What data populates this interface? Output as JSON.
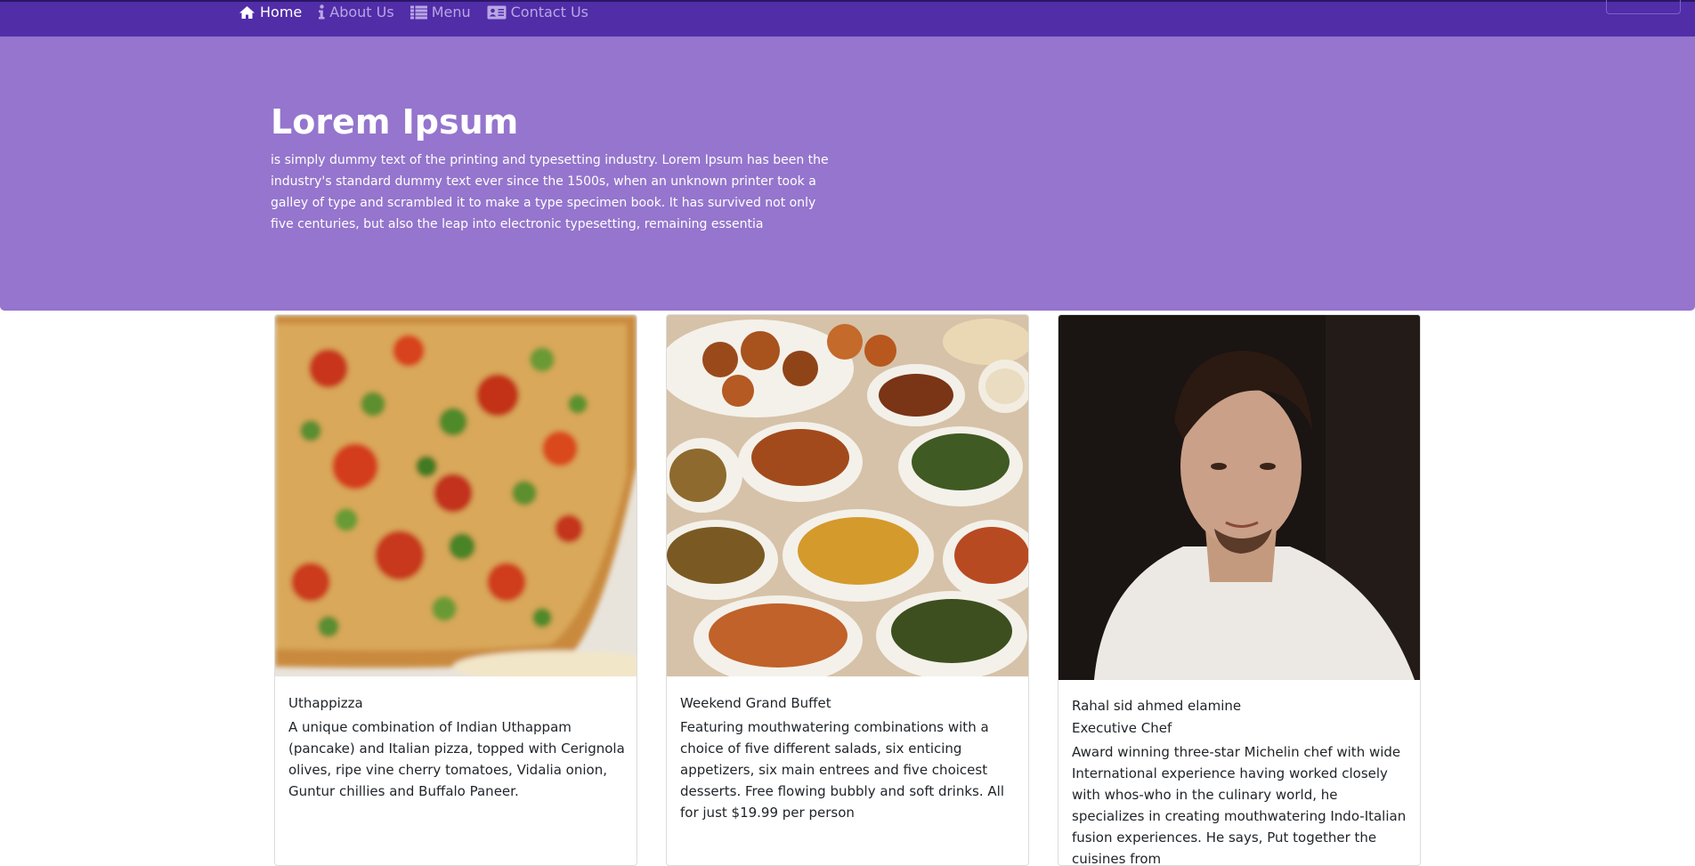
{
  "navbar": {
    "items": [
      {
        "label": "Home",
        "icon": "home-icon"
      },
      {
        "label": "About Us",
        "icon": "info-icon"
      },
      {
        "label": "Menu",
        "icon": "list-icon"
      },
      {
        "label": "Contact Us",
        "icon": "address-card-icon"
      }
    ],
    "active_color": "#ffffff",
    "inactive_color": "#b9a6e4",
    "background": "#512da8"
  },
  "jumbotron": {
    "title": "Lorem Ipsum",
    "text": "is simply dummy text of the printing and typesetting industry. Lorem Ipsum has been the industry's standard dummy text ever since the 1500s, when an unknown printer took a galley of type and scrambled it to make a type specimen book. It has survived not only five centuries, but also the leap into electronic typesetting, remaining essentia",
    "background": "#9575cd"
  },
  "cards": [
    {
      "image": "pizza-photo",
      "title": "Uthappizza",
      "text": "A unique combination of Indian Uthappam (pancake) and Italian pizza, topped with Cerignola olives, ripe vine cherry tomatoes, Vidalia onion, Guntur chillies and Buffalo Paneer."
    },
    {
      "image": "buffet-photo",
      "title": "Weekend Grand Buffet",
      "text": "Featuring mouthwatering combinations with a choice of five different salads, six enticing appetizers, six main entrees and five choicest desserts. Free flowing bubbly and soft drinks. All for just $19.99 per person"
    },
    {
      "image": "chef-photo",
      "title": "Rahal sid ahmed elamine",
      "subtitle": "Executive Chef",
      "text": "Award winning three-star Michelin chef with wide International experience having worked closely with whos-who in the culinary world, he specializes in creating mouthwatering Indo-Italian fusion experiences. He says, Put together the cuisines from"
    }
  ]
}
